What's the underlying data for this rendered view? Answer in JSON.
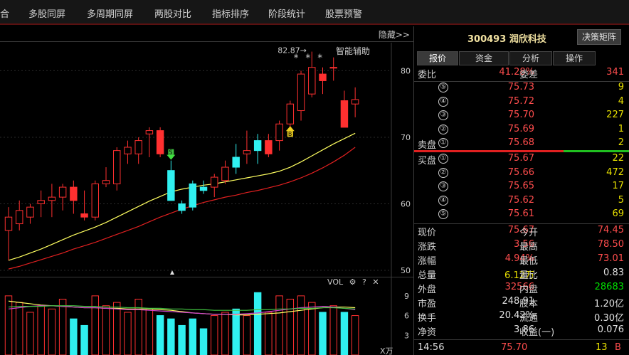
{
  "nav": {
    "items": [
      "合",
      "多股同屏",
      "多周期同屏",
      "两股对比",
      "指标排序",
      "阶段统计",
      "股票预警"
    ]
  },
  "chart": {
    "hide_label": "隐藏>>",
    "helper_label": "智能辅助",
    "high_marker": "82.87→",
    "stars": "* *  *",
    "sell_signal_label": "S",
    "buy_signal_label": "B",
    "price_ticks": [
      "80",
      "70",
      "60",
      "50"
    ],
    "vol_label": "VOL",
    "vol_ticks": [
      "9",
      "6",
      "3"
    ],
    "vol_unit": "X万"
  },
  "colors": {
    "up": "#ff3030",
    "down": "#30f0f0",
    "ma_yellow": "#ffff60",
    "ma_red": "#e02020",
    "ma_purple": "#d040d0",
    "ma_green": "#40c040"
  },
  "chart_data": {
    "type": "candlestick",
    "title": "",
    "ylim": [
      50,
      84
    ],
    "candles": [
      {
        "o": 56.0,
        "h": 59.5,
        "l": 51.5,
        "c": 58.0,
        "dir": "up"
      },
      {
        "o": 57.0,
        "h": 60.5,
        "l": 56.0,
        "c": 59.0,
        "dir": "up"
      },
      {
        "o": 58.0,
        "h": 60.0,
        "l": 57.0,
        "c": 59.5,
        "dir": "up"
      },
      {
        "o": 60.0,
        "h": 62.0,
        "l": 58.0,
        "c": 60.5,
        "dir": "up"
      },
      {
        "o": 60.5,
        "h": 63.0,
        "l": 58.0,
        "c": 61.0,
        "dir": "up"
      },
      {
        "o": 61.0,
        "h": 63.0,
        "l": 59.0,
        "c": 62.5,
        "dir": "up"
      },
      {
        "o": 62.5,
        "h": 63.5,
        "l": 58.5,
        "c": 60.5,
        "dir": "down_red"
      },
      {
        "o": 58.0,
        "h": 62.0,
        "l": 57.5,
        "c": 58.5,
        "dir": "down_red"
      },
      {
        "o": 58.0,
        "h": 63.5,
        "l": 57.5,
        "c": 63.0,
        "dir": "up"
      },
      {
        "o": 63.0,
        "h": 65.5,
        "l": 62.5,
        "c": 63.5,
        "dir": "up"
      },
      {
        "o": 63.0,
        "h": 68.5,
        "l": 62.0,
        "c": 68.0,
        "dir": "up"
      },
      {
        "o": 67.5,
        "h": 69.5,
        "l": 66.0,
        "c": 68.5,
        "dir": "up"
      },
      {
        "o": 67.5,
        "h": 70.0,
        "l": 66.0,
        "c": 69.5,
        "dir": "up"
      },
      {
        "o": 71.0,
        "h": 71.5,
        "l": 67.0,
        "c": 70.5,
        "dir": "up"
      },
      {
        "o": 71.0,
        "h": 71.5,
        "l": 67.0,
        "c": 67.5,
        "dir": "down_red"
      },
      {
        "o": 65.0,
        "h": 66.5,
        "l": 60.5,
        "c": 60.5,
        "dir": "down"
      },
      {
        "o": 60.0,
        "h": 60.5,
        "l": 58.5,
        "c": 59.0,
        "dir": "down"
      },
      {
        "o": 59.5,
        "h": 63.5,
        "l": 59.0,
        "c": 63.0,
        "dir": "down"
      },
      {
        "o": 62.5,
        "h": 63.5,
        "l": 61.5,
        "c": 62.0,
        "dir": "down"
      },
      {
        "o": 62.5,
        "h": 64.5,
        "l": 61.0,
        "c": 64.0,
        "dir": "up"
      },
      {
        "o": 63.5,
        "h": 66.5,
        "l": 63.0,
        "c": 65.5,
        "dir": "up"
      },
      {
        "o": 65.5,
        "h": 69.0,
        "l": 64.5,
        "c": 67.0,
        "dir": "down"
      },
      {
        "o": 67.5,
        "h": 71.0,
        "l": 66.0,
        "c": 68.0,
        "dir": "up"
      },
      {
        "o": 68.0,
        "h": 70.5,
        "l": 66.0,
        "c": 69.5,
        "dir": "down"
      },
      {
        "o": 69.5,
        "h": 70.5,
        "l": 67.0,
        "c": 67.5,
        "dir": "down_red"
      },
      {
        "o": 69.5,
        "h": 72.5,
        "l": 68.0,
        "c": 72.0,
        "dir": "up"
      },
      {
        "o": 72.0,
        "h": 75.5,
        "l": 71.5,
        "c": 75.0,
        "dir": "up"
      },
      {
        "o": 74.0,
        "h": 80.0,
        "l": 72.5,
        "c": 79.5,
        "dir": "up"
      },
      {
        "o": 76.5,
        "h": 82.87,
        "l": 76.0,
        "c": 80.5,
        "dir": "up"
      },
      {
        "o": 78.5,
        "h": 80.5,
        "l": 76.5,
        "c": 79.5,
        "dir": "down_red"
      },
      {
        "o": 80.5,
        "h": 82.0,
        "l": 78.5,
        "c": 80.5,
        "dir": "up"
      },
      {
        "o": 75.5,
        "h": 77.0,
        "l": 71.5,
        "c": 71.5,
        "dir": "down_red"
      },
      {
        "o": 75.0,
        "h": 77.5,
        "l": 73.0,
        "c": 75.67,
        "dir": "up"
      }
    ],
    "ma_yellow": [
      51.5,
      52.0,
      52.6,
      53.2,
      53.9,
      54.6,
      55.3,
      55.9,
      56.5,
      57.2,
      58.0,
      58.8,
      59.6,
      60.4,
      61.1,
      61.8,
      62.2,
      62.5,
      62.8,
      63.0,
      63.3,
      63.6,
      63.9,
      64.2,
      64.5,
      64.9,
      65.5,
      66.3,
      67.2,
      68.1,
      69.0,
      69.8,
      70.6
    ],
    "ma_red": [
      50.2,
      50.6,
      51.1,
      51.6,
      52.1,
      52.6,
      53.2,
      53.7,
      54.2,
      54.8,
      55.4,
      56.0,
      56.6,
      57.3,
      58.0,
      58.6,
      59.2,
      59.7,
      60.2,
      60.6,
      61.0,
      61.3,
      61.7,
      62.0,
      62.4,
      62.8,
      63.3,
      63.9,
      64.6,
      65.4,
      66.3,
      67.3,
      68.5
    ],
    "volume": [
      {
        "v": 9.0,
        "dir": "up"
      },
      {
        "v": 8.0,
        "dir": "up"
      },
      {
        "v": 6.5,
        "dir": "up"
      },
      {
        "v": 7.5,
        "dir": "up"
      },
      {
        "v": 7.0,
        "dir": "up"
      },
      {
        "v": 8.5,
        "dir": "up"
      },
      {
        "v": 5.5,
        "dir": "down"
      },
      {
        "v": 4.5,
        "dir": "down"
      },
      {
        "v": 9.0,
        "dir": "up"
      },
      {
        "v": 7.5,
        "dir": "up"
      },
      {
        "v": 8.0,
        "dir": "up"
      },
      {
        "v": 6.5,
        "dir": "up"
      },
      {
        "v": 8.5,
        "dir": "up"
      },
      {
        "v": 7.0,
        "dir": "up"
      },
      {
        "v": 6.0,
        "dir": "down"
      },
      {
        "v": 5.5,
        "dir": "down"
      },
      {
        "v": 4.5,
        "dir": "down"
      },
      {
        "v": 5.5,
        "dir": "down"
      },
      {
        "v": 4.0,
        "dir": "down"
      },
      {
        "v": 6.0,
        "dir": "up"
      },
      {
        "v": 6.5,
        "dir": "up"
      },
      {
        "v": 7.0,
        "dir": "down"
      },
      {
        "v": 6.0,
        "dir": "up"
      },
      {
        "v": 9.5,
        "dir": "down"
      },
      {
        "v": 6.5,
        "dir": "up"
      },
      {
        "v": 9.0,
        "dir": "up"
      },
      {
        "v": 8.5,
        "dir": "up"
      },
      {
        "v": 9.0,
        "dir": "up"
      },
      {
        "v": 8.0,
        "dir": "up"
      },
      {
        "v": 6.5,
        "dir": "down"
      },
      {
        "v": 7.5,
        "dir": "up"
      },
      {
        "v": 6.5,
        "dir": "down"
      },
      {
        "v": 6.0,
        "dir": "up"
      }
    ],
    "vol_ma": [
      [
        8.2,
        8.0,
        7.8,
        7.6,
        7.5,
        7.4,
        7.3,
        7.2,
        7.2,
        7.1,
        7.1,
        7.0,
        7.0,
        7.0,
        6.9,
        6.8,
        6.6,
        6.4,
        6.3,
        6.2,
        6.2,
        6.1,
        6.1,
        6.2,
        6.3,
        6.4,
        6.6,
        6.8,
        7.0,
        7.2,
        7.3,
        7.3,
        7.2
      ],
      [
        7.0,
        7.2,
        7.4,
        7.5,
        7.5,
        7.4,
        7.3,
        7.2,
        7.2,
        7.1,
        7.0,
        6.9,
        6.9,
        6.8,
        6.7,
        6.6,
        6.5,
        6.4,
        6.3,
        6.2,
        6.2,
        6.2,
        6.3,
        6.4,
        6.6,
        6.8,
        7.0,
        7.2,
        7.3,
        7.4,
        7.3,
        7.1,
        6.9
      ],
      [
        7.3,
        7.4,
        7.4,
        7.4,
        7.5,
        7.5,
        7.5,
        7.4,
        7.4,
        7.3,
        7.3,
        7.2,
        7.2,
        7.1,
        7.1,
        7.0,
        7.0,
        6.9,
        6.9,
        6.8,
        6.8,
        6.8,
        6.8,
        6.9,
        6.9,
        7.0,
        7.0,
        7.1,
        7.1,
        7.2,
        7.2,
        7.1,
        7.0
      ]
    ]
  },
  "right": {
    "code": "300493",
    "name": "润欣科技",
    "decision_btn": "决策矩阵",
    "tabs": [
      "报价",
      "资金",
      "分析",
      "操作"
    ],
    "weibi_label": "委比",
    "weibi_value": "41.28%",
    "weicha_label": "委差",
    "weicha_value": "341",
    "sell": [
      {
        "num": "⑤",
        "price": "75.73",
        "vol": "9"
      },
      {
        "num": "④",
        "price": "75.72",
        "vol": "4"
      },
      {
        "num": "③",
        "price": "75.70",
        "vol": "227"
      },
      {
        "num": "②",
        "price": "75.69",
        "vol": "1"
      },
      {
        "num": "①",
        "label": "卖盘",
        "price": "75.68",
        "vol": "2"
      }
    ],
    "buy": [
      {
        "num": "①",
        "label": "买盘",
        "price": "75.67",
        "vol": "22"
      },
      {
        "num": "②",
        "price": "75.66",
        "vol": "472"
      },
      {
        "num": "③",
        "price": "75.65",
        "vol": "17"
      },
      {
        "num": "④",
        "price": "75.62",
        "vol": "5"
      },
      {
        "num": "⑤",
        "price": "75.61",
        "vol": "69"
      }
    ],
    "quotes": [
      {
        "l1": "现价",
        "v1": "75.67",
        "c1": "red",
        "l2": "今开",
        "v2": "74.45",
        "c2": "red"
      },
      {
        "l1": "涨跌",
        "v1": "3.56",
        "c1": "red",
        "l2": "最高",
        "v2": "78.50",
        "c2": "red"
      },
      {
        "l1": "涨幅",
        "v1": "4.94%",
        "c1": "red",
        "l2": "最低",
        "v2": "73.01",
        "c2": "red"
      },
      {
        "l1": "总量",
        "v1": "6.12万",
        "c1": "yel",
        "l2": "量比",
        "v2": "0.83",
        "c2": "white"
      },
      {
        "l1": "外盘",
        "v1": "32566",
        "c1": "red",
        "l2": "内盘",
        "v2": "28683",
        "c2": "green"
      },
      {
        "l1": "市盈",
        "v1": "248.91",
        "c1": "white",
        "l2": "股本",
        "v2": "1.20亿",
        "c2": "white"
      },
      {
        "l1": "换手",
        "v1": "20.42%",
        "c1": "white",
        "l2": "流通",
        "v2": "0.30亿",
        "c2": "white"
      },
      {
        "l1": "净资",
        "v1": "3.86",
        "c1": "white",
        "l2": "收益(一)",
        "v2": "0.076",
        "c2": "white"
      }
    ],
    "bottom": {
      "time": "14:56",
      "price": "75.70",
      "vol": "13",
      "side": "B"
    }
  }
}
